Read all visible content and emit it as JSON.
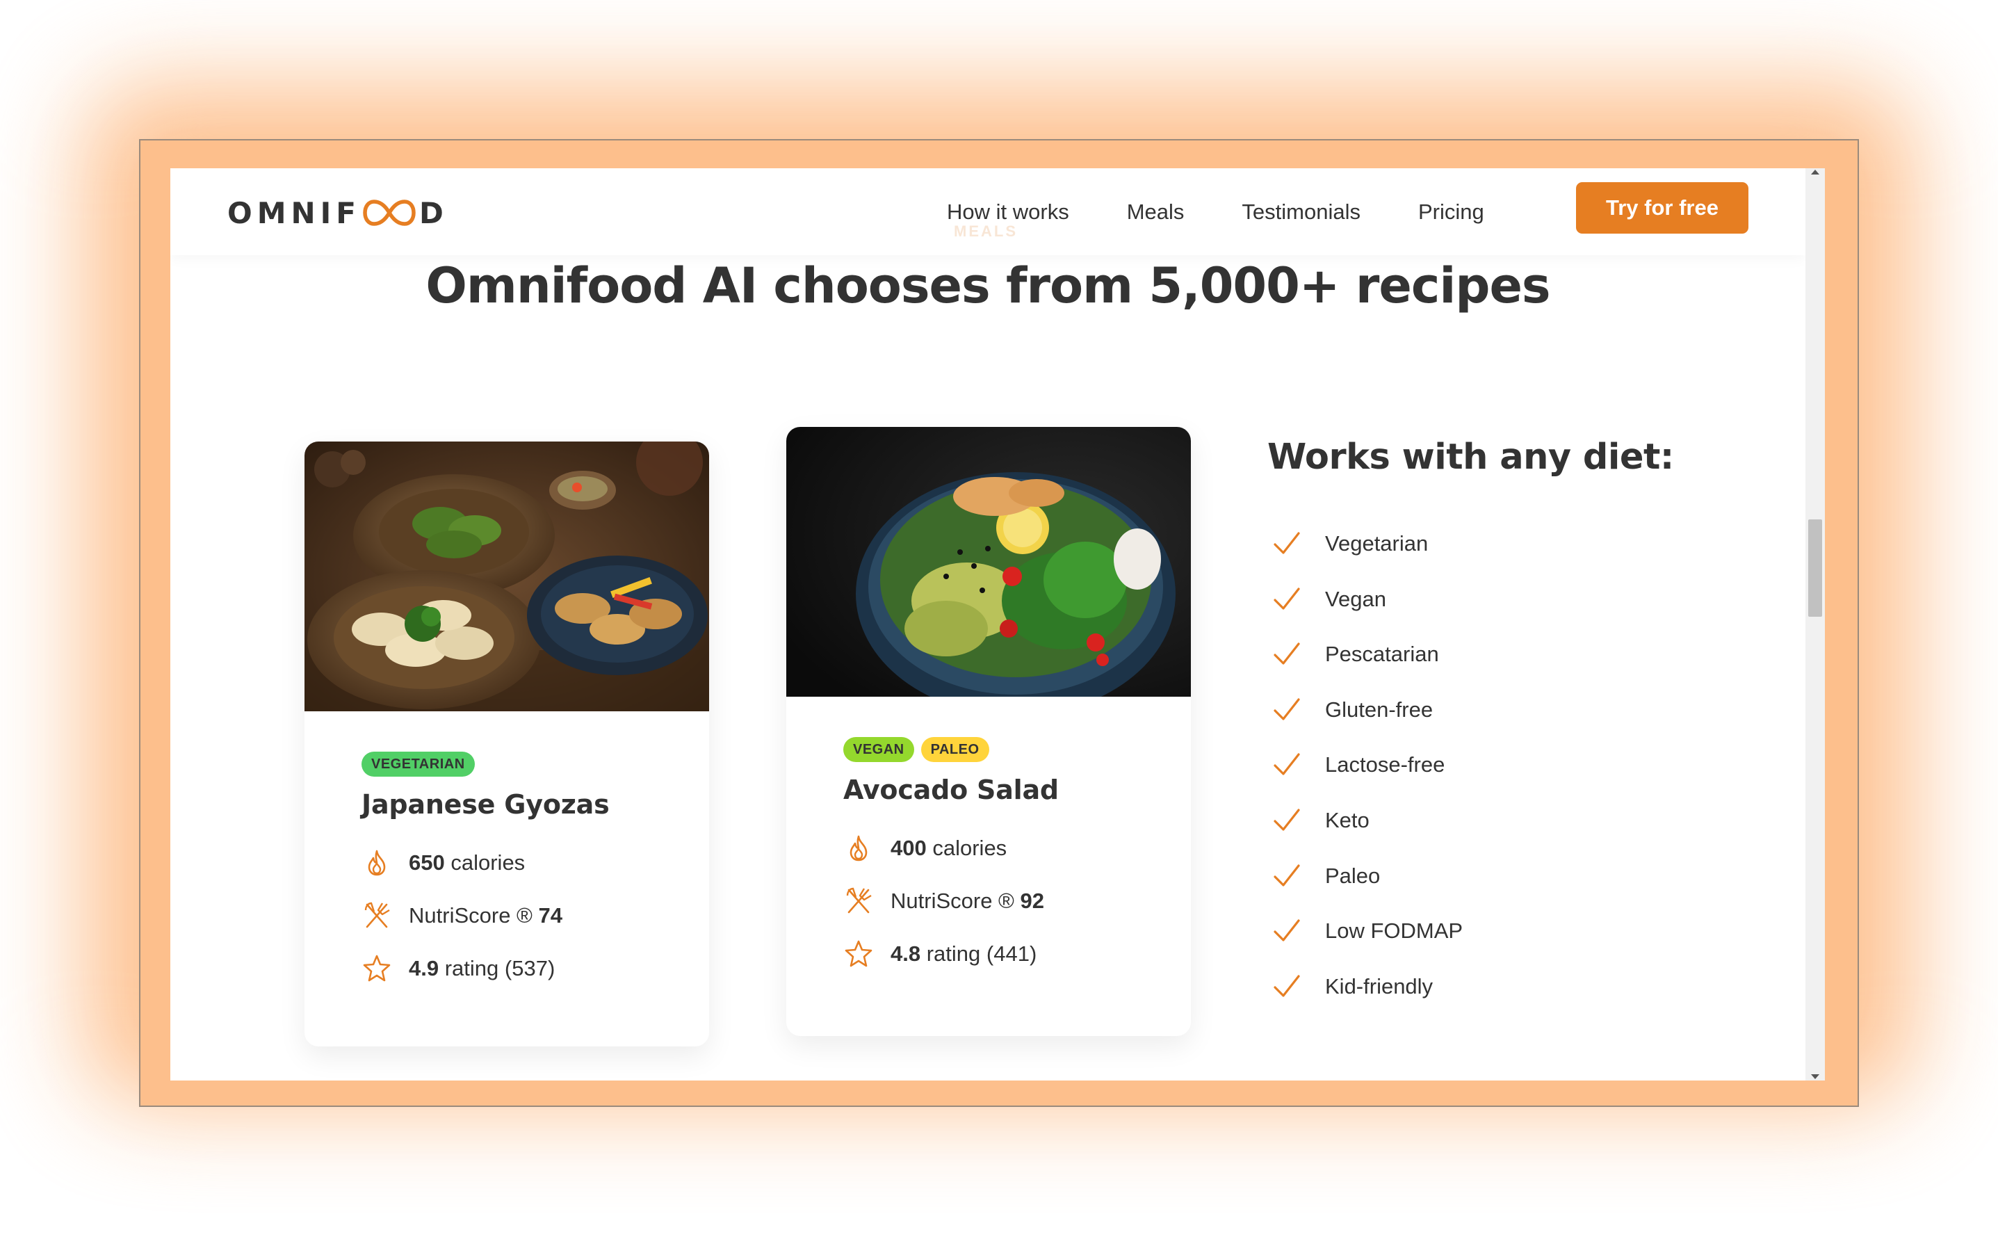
{
  "colors": {
    "accent": "#e67e22",
    "frame": "#fdbf8c",
    "text": "#333333",
    "tag_vegetarian": "#51cf66",
    "tag_vegan": "#94d82d",
    "tag_paleo": "#ffd43b"
  },
  "header": {
    "logo_left": "OMNIF",
    "logo_right": "D",
    "nav": [
      "How it works",
      "Meals",
      "Testimonials",
      "Pricing"
    ],
    "cta": "Try for free",
    "ghost_label": "MEALS"
  },
  "section": {
    "heading": "Omnifood AI chooses from 5,000+ recipes"
  },
  "meals": [
    {
      "image": "japanese-gyozas-photo",
      "tags": [
        "VEGETARIAN"
      ],
      "title": "Japanese Gyozas",
      "calories_value": "650",
      "calories_unit": "calories",
      "nutri_label": "NutriScore ®",
      "nutri_value": "74",
      "rating_value": "4.9",
      "rating_rest": "rating (537)"
    },
    {
      "image": "avocado-salad-photo",
      "tags": [
        "VEGAN",
        "PALEO"
      ],
      "title": "Avocado Salad",
      "calories_value": "400",
      "calories_unit": "calories",
      "nutri_label": "NutriScore ®",
      "nutri_value": "92",
      "rating_value": "4.8",
      "rating_rest": "rating (441)"
    }
  ],
  "diets": {
    "title": "Works with any diet:",
    "items": [
      "Vegetarian",
      "Vegan",
      "Pescatarian",
      "Gluten-free",
      "Lactose-free",
      "Keto",
      "Paleo",
      "Low FODMAP",
      "Kid-friendly"
    ]
  },
  "icons": {
    "attr": [
      "flame-icon",
      "utensils-icon",
      "star-icon"
    ],
    "diet": "check-icon"
  }
}
